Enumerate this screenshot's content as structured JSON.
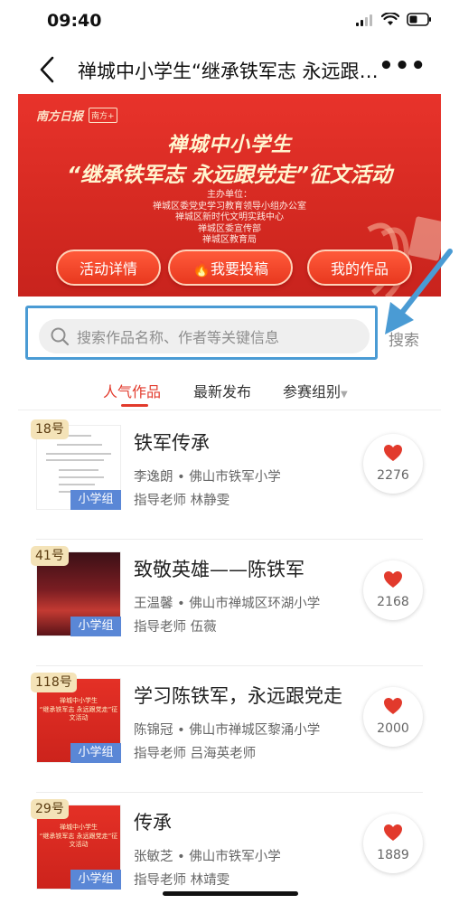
{
  "status_bar": {
    "time": "09:40"
  },
  "nav": {
    "title": "禅城中小学生“继承铁军志 永远跟党走”征文活动"
  },
  "banner": {
    "logo_text": "南方日报",
    "logo_box": "南方+",
    "title_line1": "禅城中小学生",
    "title_line2": "“继承铁军志 永远跟党走”征文活动",
    "organizers": [
      "主办单位：",
      "禅城区委党史学习教育领导小组办公室",
      "禅城区新时代文明实践中心",
      "禅城区委宣传部",
      "禅城区教育局"
    ],
    "buttons": {
      "details": "活动详情",
      "submit": "🔥我要投稿",
      "my_works": "我的作品"
    }
  },
  "search": {
    "placeholder": "搜索作品名称、作者等关键信息",
    "button": "搜索"
  },
  "tabs": {
    "popular": "人气作品",
    "latest": "最新发布",
    "group": "参赛组别"
  },
  "items": [
    {
      "badge": "18号",
      "group": "小学组",
      "title": "铁军传承",
      "author": "李逸朗 • 佛山市铁军小学",
      "teacher": "指导老师  林静雯",
      "likes": "2276"
    },
    {
      "badge": "41号",
      "group": "小学组",
      "title": "致敬英雄——陈铁军",
      "author": "王温馨 • 佛山市禅城区环湖小学",
      "teacher": "指导老师  伍薇",
      "likes": "2168"
    },
    {
      "badge": "118号",
      "group": "小学组",
      "title": "学习陈铁军，永远跟党走",
      "author": "陈锦冠 • 佛山市禅城区黎涌小学",
      "teacher": "指导老师  吕海英老师",
      "likes": "2000"
    },
    {
      "badge": "29号",
      "group": "小学组",
      "title": "传承",
      "author": "张敏芝 • 佛山市铁军小学",
      "teacher": "指导老师  林靖雯",
      "likes": "1889"
    }
  ],
  "colors": {
    "accent": "#e23a2c",
    "banner": "#d62a22",
    "group_badge": "#5a87d6",
    "highlight": "#4a9bd4"
  }
}
